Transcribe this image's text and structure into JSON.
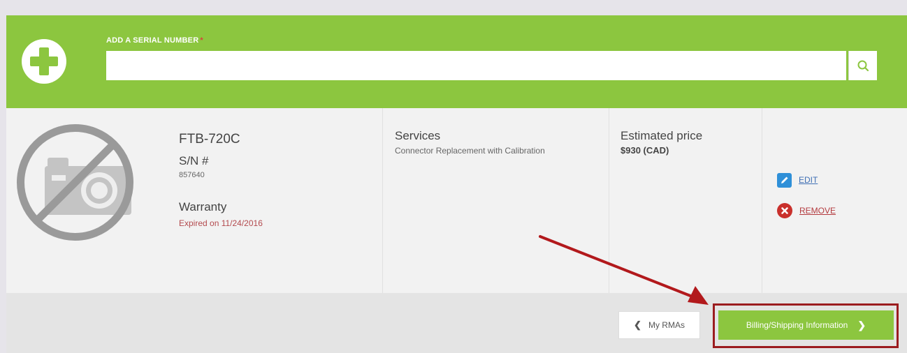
{
  "serial": {
    "label": "ADD A SERIAL NUMBER",
    "required_marker": "*",
    "value": "",
    "placeholder": ""
  },
  "product": {
    "model": "FTB-720C",
    "sn_label": "S/N #",
    "sn_value": "857640",
    "warranty_label": "Warranty",
    "warranty_value": "Expired on 11/24/2016"
  },
  "services": {
    "label": "Services",
    "value": "Connector Replacement with Calibration"
  },
  "price": {
    "label": "Estimated price",
    "value": "$930 (CAD)"
  },
  "actions": {
    "edit_label": "EDIT",
    "remove_label": "REMOVE"
  },
  "footer": {
    "back_label": "My RMAs",
    "next_label": "Billing/Shipping Information"
  },
  "colors": {
    "brand_green": "#8cc63f",
    "warning_red": "#b34a4e",
    "link_blue": "#3f6fb4",
    "annotation_red": "#9b1c1f"
  },
  "icons": {
    "add": "plus-circle-icon",
    "search": "search-icon",
    "no_photo": "no-photo-icon",
    "edit": "pencil-icon",
    "remove": "close-circle-icon",
    "back": "chevron-left-icon",
    "next": "chevron-right-icon"
  }
}
